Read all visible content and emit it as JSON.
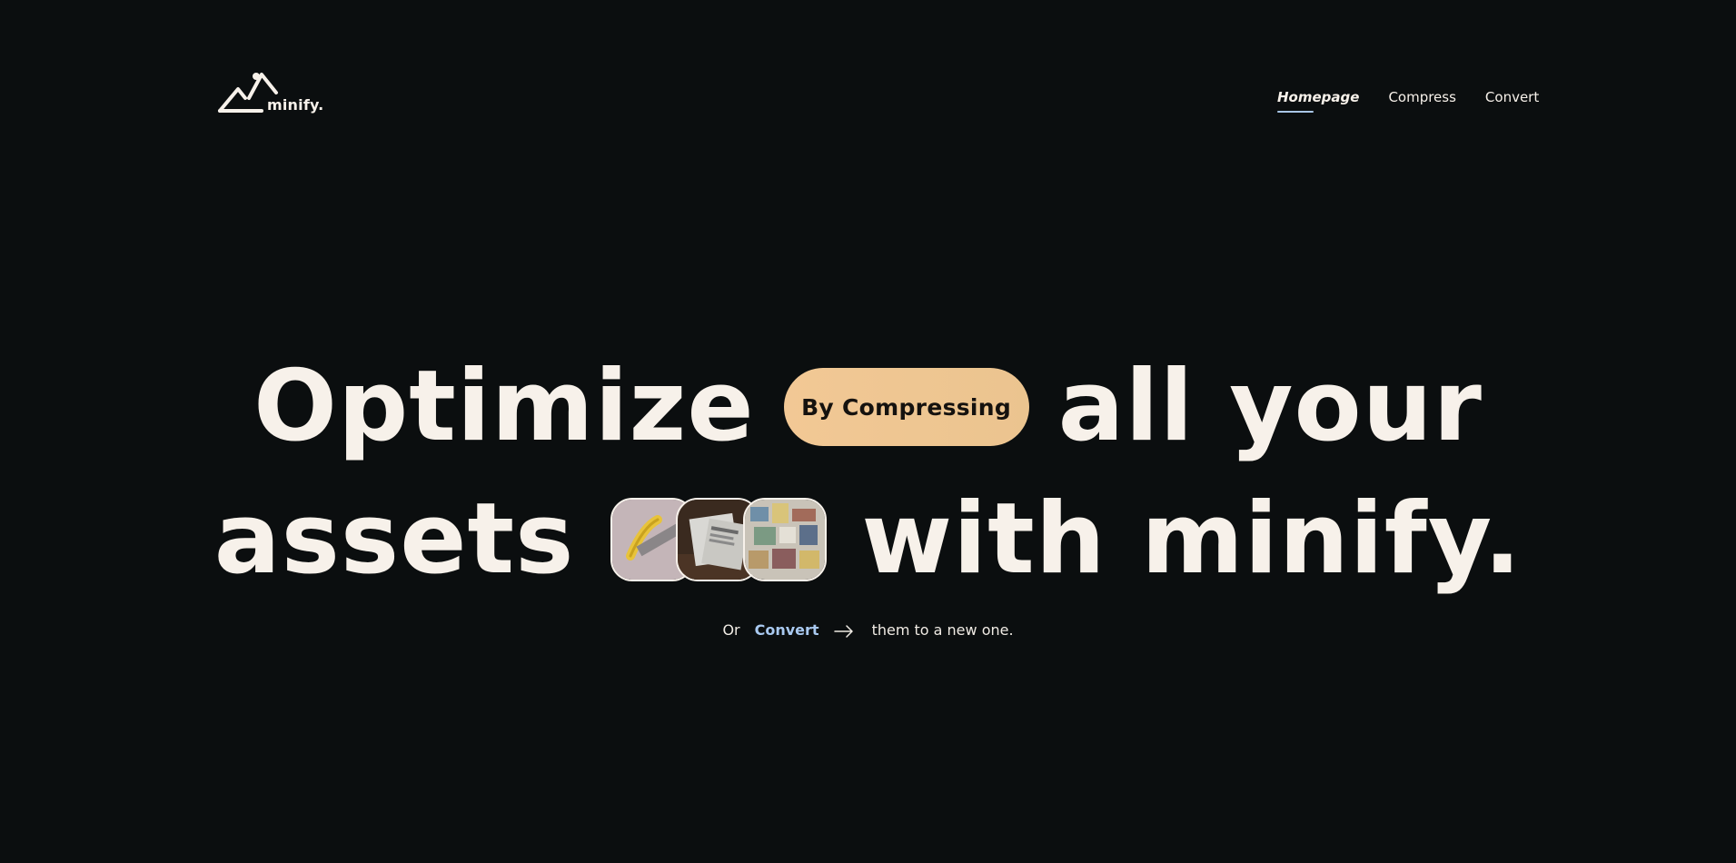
{
  "brand": {
    "name": "minify.",
    "text_color": "#f7f1ea"
  },
  "nav": {
    "items": [
      {
        "label": "Homepage",
        "active": true
      },
      {
        "label": "Compress",
        "active": false
      },
      {
        "label": "Convert",
        "active": false
      }
    ],
    "active_underline_color": "#a9c6e6"
  },
  "hero": {
    "word_optimize": "Optimize",
    "pill_label": "By Compressing",
    "words_all_your": "all your",
    "word_assets": "assets",
    "words_with_minify": "with minify.",
    "thumbnails": [
      {
        "icon": "banana-duct-tape-image"
      },
      {
        "icon": "newspaper-image"
      },
      {
        "icon": "collage-image"
      }
    ],
    "pill_color": "#f0c792",
    "text_color": "#f7f1ea"
  },
  "subline": {
    "prefix": "Or",
    "link": "Convert",
    "suffix": "them to a new one.",
    "link_color": "#a9c9f0",
    "arrow_icon": "arrow-right-icon"
  },
  "background_color": "#0b0e0f"
}
